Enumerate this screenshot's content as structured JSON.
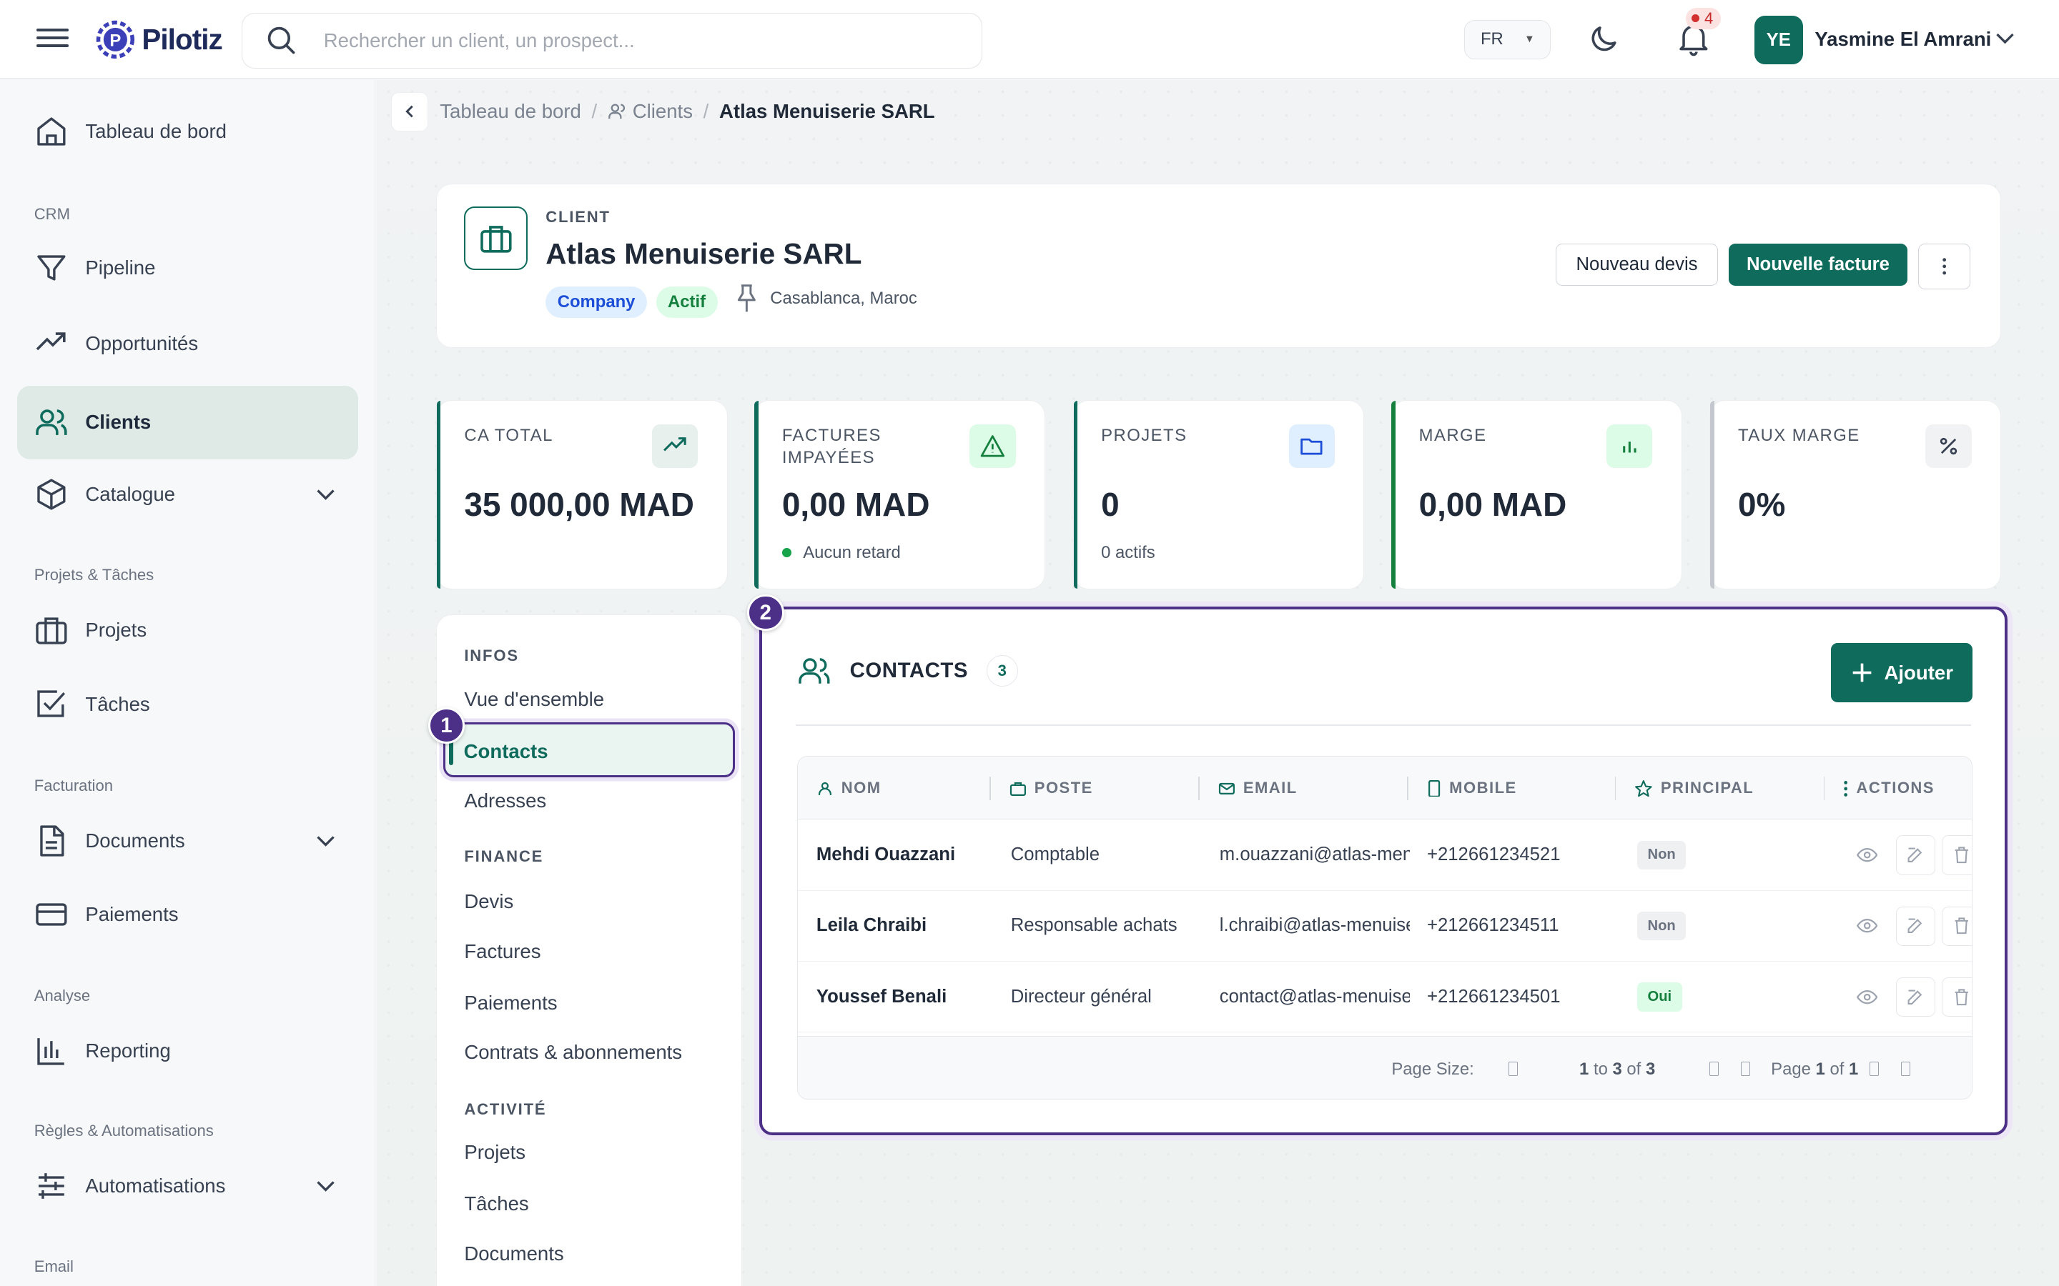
{
  "app": {
    "brand": "Pilotiz"
  },
  "search": {
    "placeholder": "Rechercher un client, un prospect..."
  },
  "topbar": {
    "lang": "FR",
    "notifications": "4",
    "user_initials": "YE",
    "user_name": "Yasmine El Amrani"
  },
  "sidebar": {
    "items": [
      {
        "label": "Tableau de bord",
        "icon": "home-icon"
      },
      {
        "label": "Pipeline",
        "icon": "filter-icon"
      },
      {
        "label": "Opportunités",
        "icon": "trending-up-icon"
      },
      {
        "label": "Clients",
        "icon": "users-icon",
        "active": true
      },
      {
        "label": "Catalogue",
        "icon": "box-icon"
      },
      {
        "label": "Projets",
        "icon": "briefcase-icon"
      },
      {
        "label": "Tâches",
        "icon": "checkbox-icon"
      },
      {
        "label": "Documents",
        "icon": "document-icon"
      },
      {
        "label": "Paiements",
        "icon": "credit-card-icon"
      },
      {
        "label": "Reporting",
        "icon": "bar-chart-icon"
      },
      {
        "label": "Automatisations",
        "icon": "sliders-icon"
      }
    ],
    "sections": [
      "CRM",
      "Projets & Tâches",
      "Facturation",
      "Analyse",
      "Règles & Automatisations",
      "Email"
    ]
  },
  "breadcrumb": {
    "home": "Tableau de bord",
    "clients": "Clients",
    "current": "Atlas Menuiserie SARL"
  },
  "client": {
    "kicker": "CLIENT",
    "name": "Atlas Menuiserie SARL",
    "type_tag": "Company",
    "status_tag": "Actif",
    "location": "Casablanca, Maroc",
    "btn_devis": "Nouveau devis",
    "btn_facture": "Nouvelle facture"
  },
  "kpis": [
    {
      "label": "CA TOTAL",
      "value": "35 000,00 MAD",
      "sub": "",
      "accent": "#0f6b5c"
    },
    {
      "label": "FACTURES IMPAYÉES",
      "value": "0,00 MAD",
      "sub": "Aucun retard",
      "accent": "#0f6b5c"
    },
    {
      "label": "PROJETS",
      "value": "0",
      "sub": "0 actifs",
      "accent": "#0f6b5c"
    },
    {
      "label": "MARGE",
      "value": "0,00 MAD",
      "sub": "",
      "accent": "#15803d"
    },
    {
      "label": "TAUX MARGE",
      "value": "0%",
      "sub": "",
      "accent": "#9ca3af"
    }
  ],
  "side_menu": {
    "sections": [
      "INFOS",
      "FINANCE",
      "ACTIVITÉ"
    ],
    "items": [
      "Vue d'ensemble",
      "Contacts",
      "Adresses",
      "Devis",
      "Factures",
      "Paiements",
      "Contrats & abonnements",
      "Projets",
      "Tâches",
      "Documents"
    ],
    "active": "Contacts"
  },
  "markers": [
    "1",
    "2"
  ],
  "contacts": {
    "title": "CONTACTS",
    "count": "3",
    "add_label": "Ajouter",
    "columns": [
      "NOM",
      "POSTE",
      "EMAIL",
      "MOBILE",
      "PRINCIPAL",
      "ACTIONS"
    ],
    "rows": [
      {
        "nom": "Mehdi Ouazzani",
        "poste": "Comptable",
        "email": "m.ouazzani@atlas-menuiserie.ma",
        "mobile": "+212661234521",
        "principal": "Non"
      },
      {
        "nom": "Leila Chraibi",
        "poste": "Responsable achats",
        "email": "l.chraibi@atlas-menuiserie.ma",
        "mobile": "+212661234511",
        "principal": "Non"
      },
      {
        "nom": "Youssef Benali",
        "poste": "Directeur général",
        "email": "contact@atlas-menuiserie.ma",
        "mobile": "+212661234501",
        "principal": "Oui"
      }
    ],
    "footer": {
      "page_size_label": "Page Size:",
      "range_a": "1",
      "range_to": "to",
      "range_b": "3",
      "range_of": "of",
      "range_c": "3",
      "page_label": "Page",
      "page_num": "1",
      "page_of": "of",
      "page_total": "1"
    }
  }
}
